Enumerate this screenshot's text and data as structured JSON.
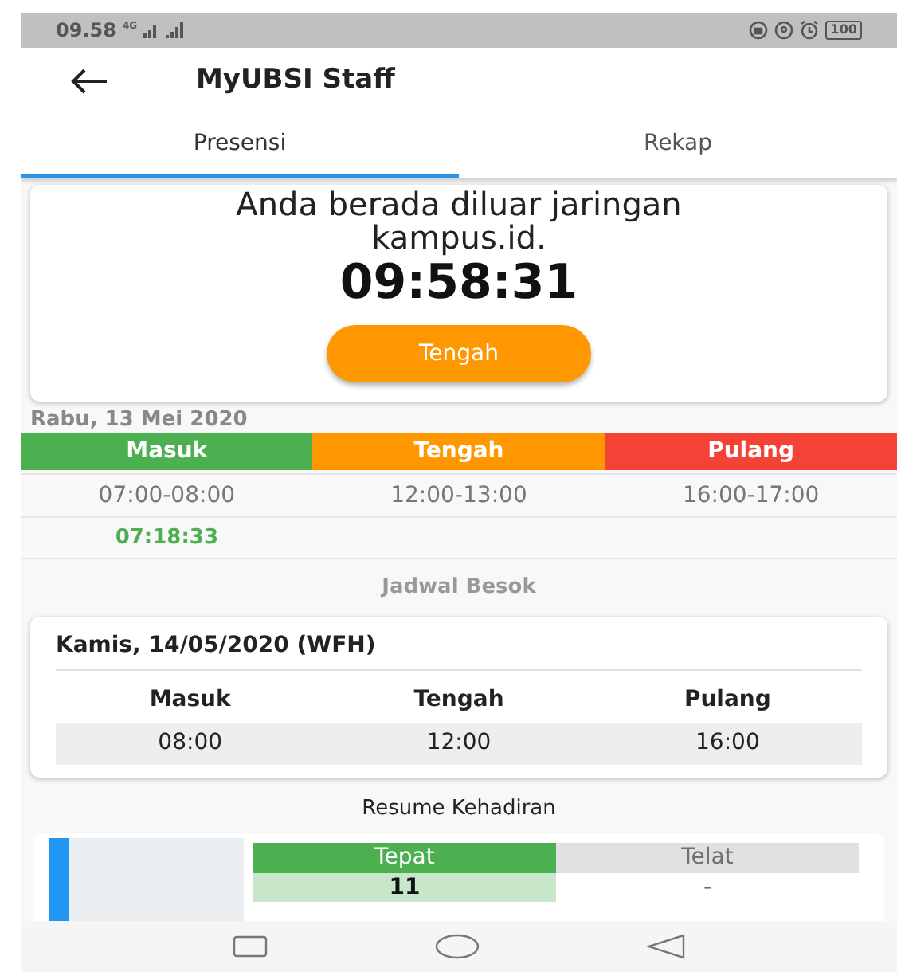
{
  "status_bar": {
    "time": "09.58",
    "network": "4G",
    "battery": "100"
  },
  "app_bar": {
    "title": "MyUBSI Staff"
  },
  "tabs": [
    {
      "label": "Presensi",
      "selected": true
    },
    {
      "label": "Rekap",
      "selected": false
    }
  ],
  "status_card": {
    "message": "Anda berada diluar jaringan kampus.id.",
    "clock": "09:58:31",
    "button": "Tengah"
  },
  "today": {
    "date": "Rabu, 13 Mei 2020",
    "sessions": [
      {
        "label": "Masuk",
        "color": "#4caf50",
        "window": "07:00-08:00",
        "checkin": "07:18:33"
      },
      {
        "label": "Tengah",
        "color": "#ff9800",
        "window": "12:00-13:00"
      },
      {
        "label": "Pulang",
        "color": "#f44336",
        "window": "16:00-17:00"
      }
    ]
  },
  "tomorrow": {
    "heading": "Jadwal Besok",
    "date": "Kamis, 14/05/2020 (WFH)",
    "columns": [
      "Masuk",
      "Tengah",
      "Pulang"
    ],
    "times": [
      "08:00",
      "12:00",
      "16:00"
    ]
  },
  "resume": {
    "heading": "Resume Kehadiran",
    "columns": [
      {
        "label": "Tepat",
        "kind": "ontime",
        "value": "11"
      },
      {
        "label": "Telat",
        "kind": "late",
        "value": "-"
      }
    ]
  }
}
